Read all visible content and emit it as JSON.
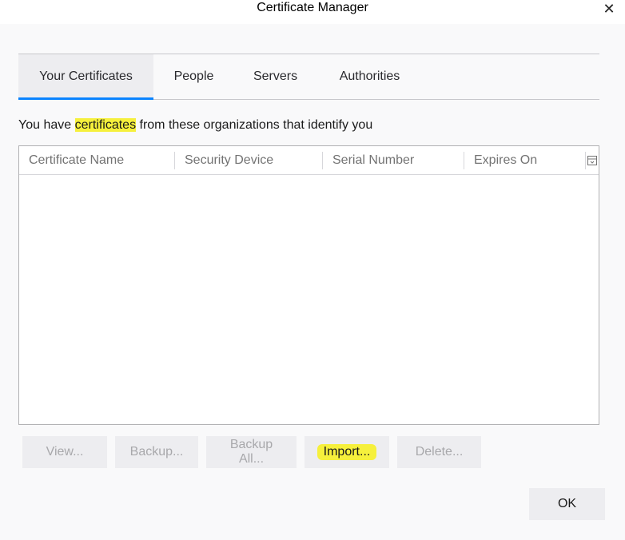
{
  "window": {
    "title": "Certificate Manager",
    "close_glyph": "✕"
  },
  "tabs": [
    {
      "label": "Your Certificates",
      "selected": true
    },
    {
      "label": "People",
      "selected": false
    },
    {
      "label": "Servers",
      "selected": false
    },
    {
      "label": "Authorities",
      "selected": false
    }
  ],
  "description": {
    "prefix": "You have ",
    "highlight": "certificates",
    "suffix": " from these organizations that identify you"
  },
  "table": {
    "columns": [
      "Certificate Name",
      "Security Device",
      "Serial Number",
      "Expires On"
    ],
    "rows": []
  },
  "buttons": {
    "view": "View...",
    "backup": "Backup...",
    "backup_all": "Backup All...",
    "import": "Import...",
    "delete": "Delete...",
    "ok": "OK"
  },
  "colors": {
    "highlight": "#f6f03c",
    "tab_accent": "#0a84ff"
  }
}
